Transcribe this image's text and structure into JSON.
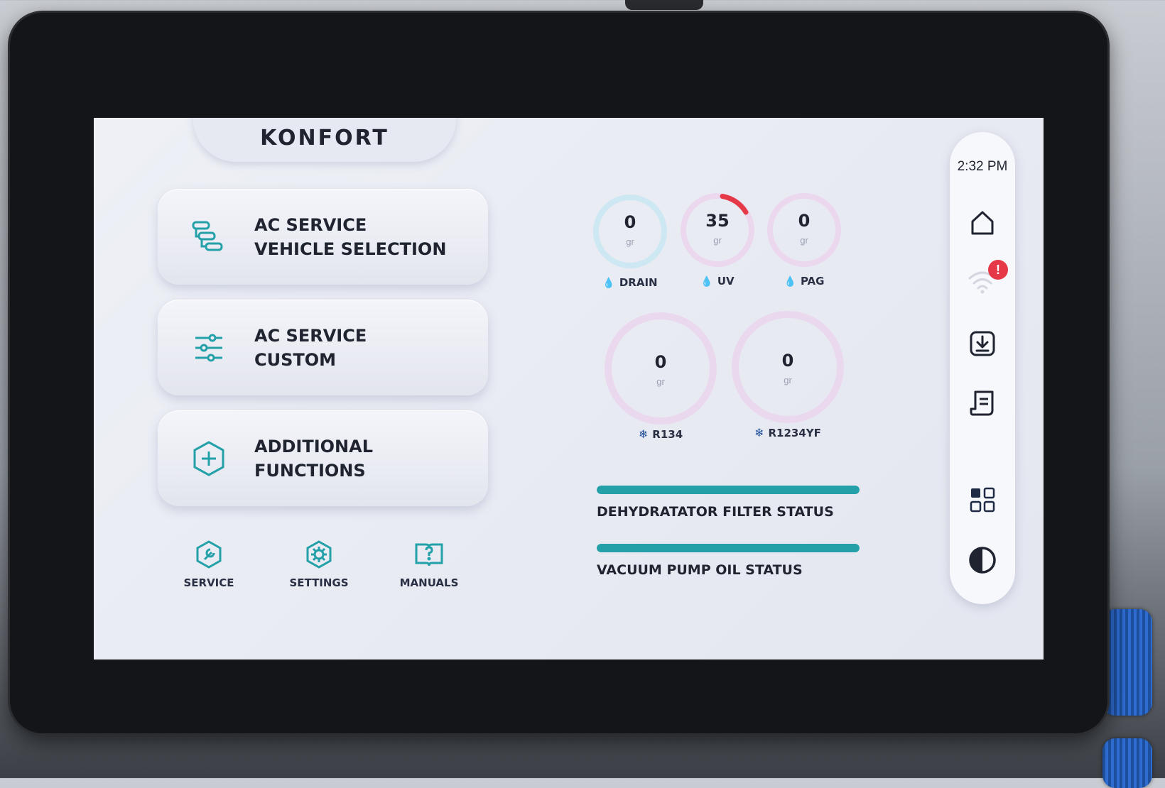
{
  "brand": {
    "logo": "KONFORT"
  },
  "menu": {
    "vehicle_selection": {
      "line1": "AC SERVICE",
      "line2": "VEHICLE SELECTION",
      "icon": "vehicle-list-icon"
    },
    "custom": {
      "line1": "AC SERVICE",
      "line2": "CUSTOM",
      "icon": "sliders-icon"
    },
    "additional": {
      "line1": "ADDITIONAL",
      "line2": "FUNCTIONS",
      "icon": "plus-hexagon-icon"
    }
  },
  "bottom_nav": {
    "service": "SERVICE",
    "settings": "SETTINGS",
    "manuals": "MANUALS"
  },
  "gauges": {
    "drain": {
      "value": "0",
      "unit": "gr",
      "label": "DRAIN"
    },
    "uv": {
      "value": "35",
      "unit": "gr",
      "label": "UV"
    },
    "pag": {
      "value": "0",
      "unit": "gr",
      "label": "PAG"
    },
    "r134": {
      "value": "0",
      "unit": "gr",
      "label": "R134"
    },
    "r1234yf": {
      "value": "0",
      "unit": "gr",
      "label": "R1234YF"
    }
  },
  "status_bars": {
    "dehydrator": {
      "label": "DEHYDRATATOR FILTER STATUS",
      "level": 1.0
    },
    "vacuum_pump": {
      "label": "VACUUM PUMP OIL STATUS",
      "level": 1.0
    }
  },
  "sidebar": {
    "time": "2:32 PM",
    "wifi_alert": "!"
  },
  "colors": {
    "accent": "#24a1a8",
    "alert": "#e53947",
    "uv_arc": "#e53947"
  }
}
